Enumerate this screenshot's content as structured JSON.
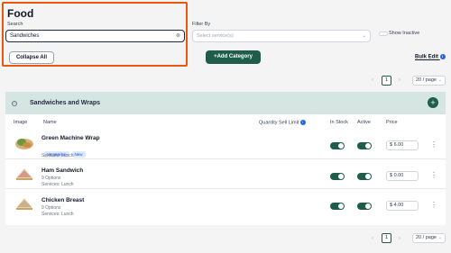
{
  "page_title": "Food",
  "search": {
    "label": "Search",
    "value": "Sandwiches",
    "clear_icon": "⊗"
  },
  "collapse_label": "Collapse All",
  "filter": {
    "label": "Filter By",
    "placeholder": "Select service(s)"
  },
  "show_inactive_label": "Show Inactive",
  "add_category_label": "+Add Category",
  "bulk_edit_label": "Bulk Edit",
  "pagination": {
    "prev": "‹",
    "page": "1",
    "next": "›",
    "per_page": "20 / page"
  },
  "category": {
    "name": "Sandwiches and Wraps",
    "collapse_symbol": "−",
    "add_symbol": "+"
  },
  "columns": {
    "image": "Image",
    "name": "Name",
    "qty": "Quantity Sell Limit",
    "stock": "In Stock",
    "active": "Active",
    "price": "Price"
  },
  "items": [
    {
      "name": "Green Machine Wrap",
      "tags": [
        "Vegetarian",
        "New"
      ],
      "options": "",
      "services": "Services: Lunch",
      "price": "$ 6.00"
    },
    {
      "name": "Ham Sandwich",
      "tags": [],
      "options": "9 Options",
      "services": "Services: Lunch",
      "price": "$ 0.00"
    },
    {
      "name": "Chicken Breast",
      "tags": [],
      "options": "9 Options",
      "services": "Services: Lunch",
      "price": "$ 4.00"
    }
  ],
  "colors": {
    "accent": "#1f5c4a",
    "highlight": "#ea580c",
    "category_bg": "#d5e6e2"
  }
}
